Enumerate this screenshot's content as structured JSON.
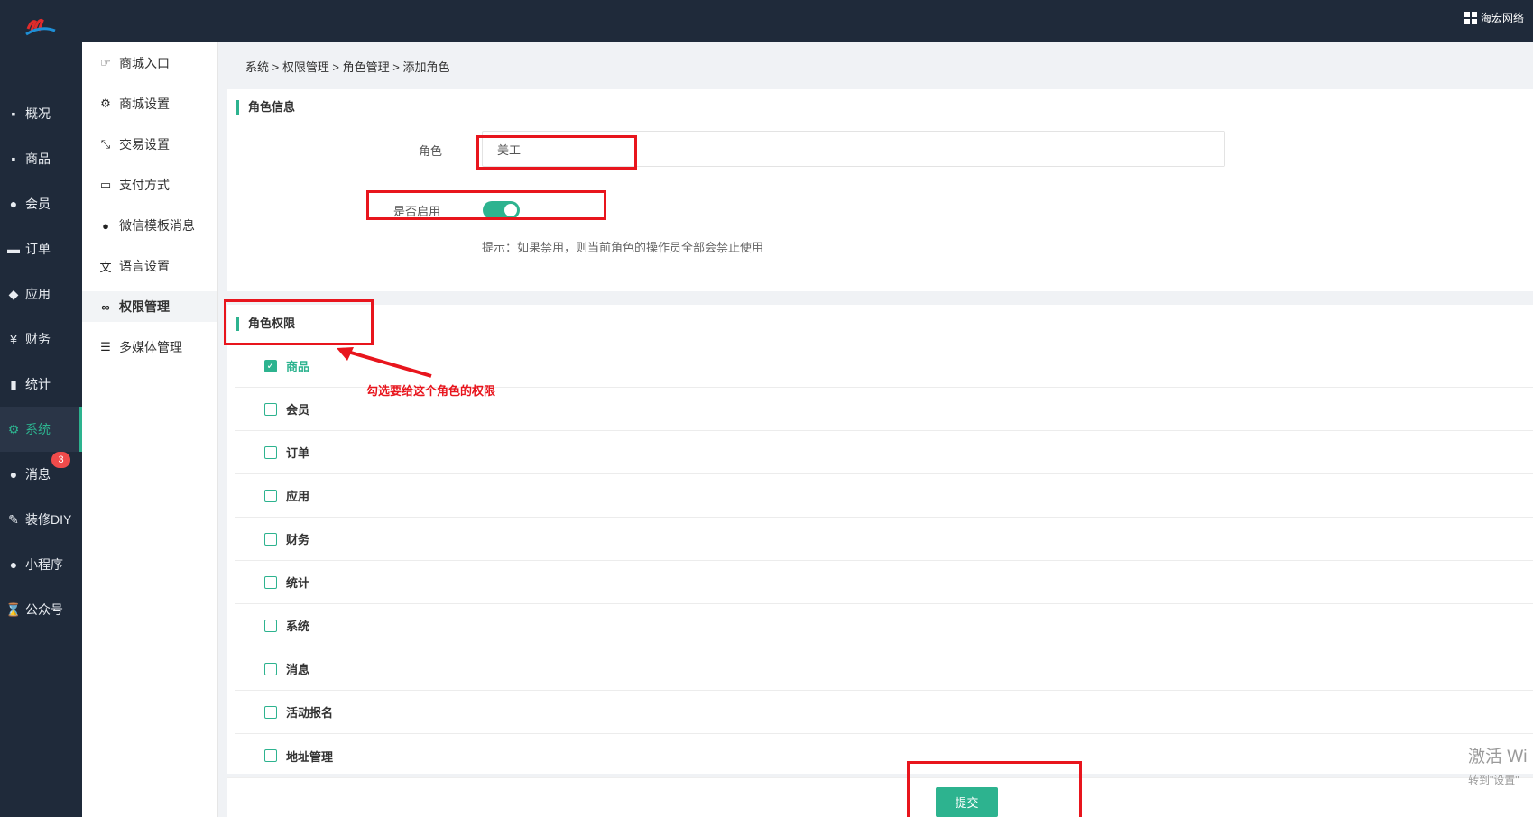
{
  "topbar": {
    "user_label": "海宏网络"
  },
  "sidebar_primary": [
    {
      "label": "概况",
      "icon": "archive-icon"
    },
    {
      "label": "商品",
      "icon": "archive-icon"
    },
    {
      "label": "会员",
      "icon": "users-icon"
    },
    {
      "label": "订单",
      "icon": "cart-icon"
    },
    {
      "label": "应用",
      "icon": "cubes-icon"
    },
    {
      "label": "财务",
      "icon": "yen-icon"
    },
    {
      "label": "统计",
      "icon": "bar-chart-icon"
    },
    {
      "label": "系统",
      "icon": "cogs-icon",
      "active": true
    },
    {
      "label": "消息",
      "icon": "comment-icon",
      "badge": "3"
    },
    {
      "label": "装修DIY",
      "icon": "gavel-icon"
    },
    {
      "label": "小程序",
      "icon": "wechat-icon"
    },
    {
      "label": "公众号",
      "icon": "hourglass-icon"
    }
  ],
  "sidebar_secondary": [
    {
      "label": "商城入口",
      "icon": "hand-pointer-icon"
    },
    {
      "label": "商城设置",
      "icon": "gear-icon"
    },
    {
      "label": "交易设置",
      "icon": "compress-icon"
    },
    {
      "label": "支付方式",
      "icon": "credit-card-icon"
    },
    {
      "label": "微信模板消息",
      "icon": "wechat-icon"
    },
    {
      "label": "语言设置",
      "icon": "language-icon"
    },
    {
      "label": "权限管理",
      "icon": "mask-icon",
      "active": true
    },
    {
      "label": "多媒体管理",
      "icon": "list-icon"
    }
  ],
  "breadcrumb": "系统 > 权限管理 > 角色管理 > 添加角色",
  "role_info": {
    "title": "角色信息",
    "role_label": "角色",
    "role_value": "美工",
    "enable_label": "是否启用",
    "enabled": true,
    "hint": "提示：如果禁用，则当前角色的操作员全部会禁止使用"
  },
  "role_permissions": {
    "title": "角色权限",
    "items": [
      {
        "label": "商品",
        "checked": true
      },
      {
        "label": "会员",
        "checked": false
      },
      {
        "label": "订单",
        "checked": false
      },
      {
        "label": "应用",
        "checked": false
      },
      {
        "label": "财务",
        "checked": false
      },
      {
        "label": "统计",
        "checked": false
      },
      {
        "label": "系统",
        "checked": false
      },
      {
        "label": "消息",
        "checked": false
      },
      {
        "label": "活动报名",
        "checked": false
      },
      {
        "label": "地址管理",
        "checked": false
      }
    ]
  },
  "annotation": "勾选要给这个角色的权限",
  "submit_label": "提交",
  "watermark": {
    "line1": "激活 Wi",
    "line2": "转到\"设置\""
  },
  "colors": {
    "accent": "#2db38f",
    "sidebar_bg": "#1f2a3a",
    "annotation_red": "#e8151d",
    "badge_red": "#f04b4b"
  }
}
